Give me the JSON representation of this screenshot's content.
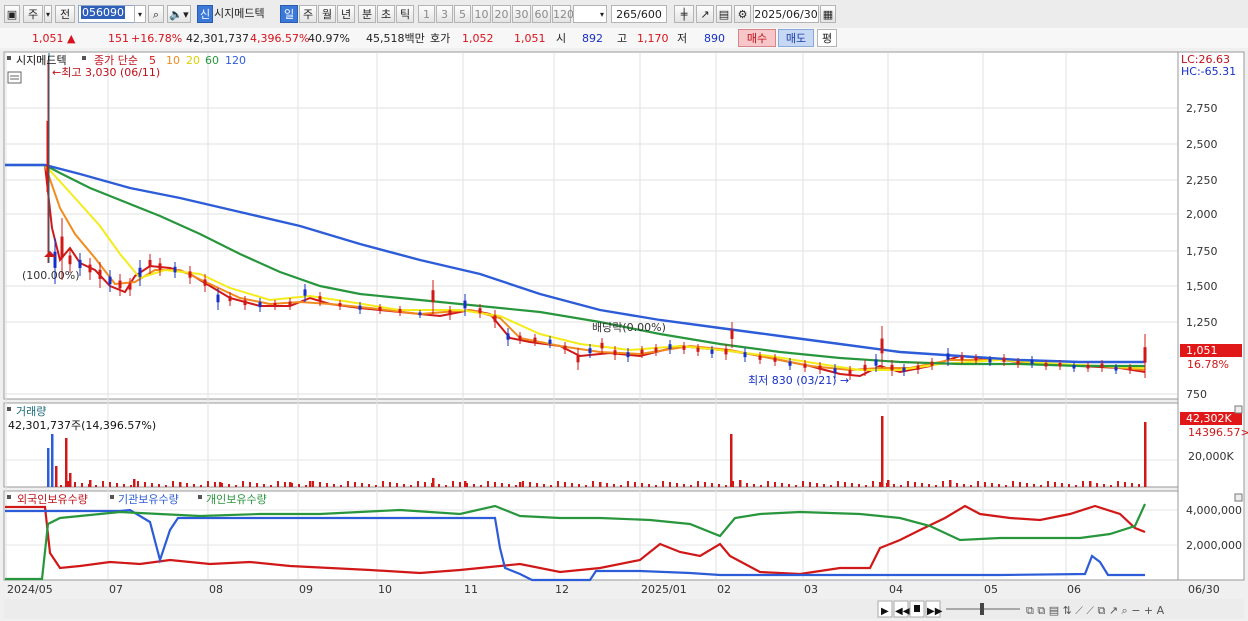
{
  "toolbar": {
    "period_select": "주",
    "scope_select": "전",
    "code": "056090",
    "stock_name": "시지메드텍",
    "badge_new": "신",
    "periods": [
      "일",
      "주",
      "월",
      "년",
      "분",
      "초",
      "틱"
    ],
    "active_period": "일",
    "intervals": [
      "1",
      "3",
      "5",
      "10",
      "20",
      "30",
      "60",
      "120"
    ],
    "count_current": "265",
    "count_max": "/600",
    "date": "2025/06/30"
  },
  "info": {
    "price": "1,051",
    "change": "151",
    "change_pct": "+16.78%",
    "volume": "42,301,737",
    "volume_pct": "4,396.57%",
    "turnover": "40.97%",
    "amount": "45,518백만",
    "quote_label": "호가",
    "ask": "1,052",
    "bid": "1,051",
    "open_label": "시",
    "open": "892",
    "high_label": "고",
    "high": "1,170",
    "low_label": "저",
    "low": "890",
    "buy_button": "매수",
    "sell_button": "매도",
    "avg_button": "평"
  },
  "price_panel": {
    "title": "시지메드텍",
    "ma_label": "종가 단순",
    "ma_periods": [
      "5",
      "10",
      "20",
      "60",
      "120"
    ],
    "ma_colors": [
      "#d01818",
      "#f08c1e",
      "#f4ec1a",
      "#28963c",
      "#2c5cd8"
    ],
    "lc_label": "LC:26.63",
    "hc_label": "HC:-65.31",
    "high_annot": "←최고 3,030 (06/11)",
    "low_annot": "최저 830 (03/21) →",
    "split_annot": "(100.00%)",
    "dividend_annot": "배당락(0.00%)",
    "y_ticks": [
      "2,750",
      "2,500",
      "2,250",
      "2,000",
      "1,750",
      "1,500",
      "1,250",
      "750"
    ],
    "price_tag": "1,051",
    "pct_tag": "16.78%"
  },
  "volume_panel": {
    "title": "거래량",
    "value_label": "42,301,737주(14,396.57%)",
    "tag_value": "42,302K",
    "tag_pct": "14396.57>",
    "y_tick": "20,000K"
  },
  "holding_panel": {
    "series_labels": [
      "외국인보유수량",
      "기관보유수량",
      "개인보유수량"
    ],
    "series_colors": [
      "#d01818",
      "#2c5cd8",
      "#28963c"
    ],
    "y_ticks": [
      "4,000,000",
      "2,000,000"
    ]
  },
  "x_axis": {
    "labels": [
      "2024/05",
      "07",
      "08",
      "09",
      "10",
      "11",
      "12",
      "2025/01",
      "02",
      "03",
      "04",
      "05",
      "06"
    ],
    "right_label": "06/30"
  }
}
